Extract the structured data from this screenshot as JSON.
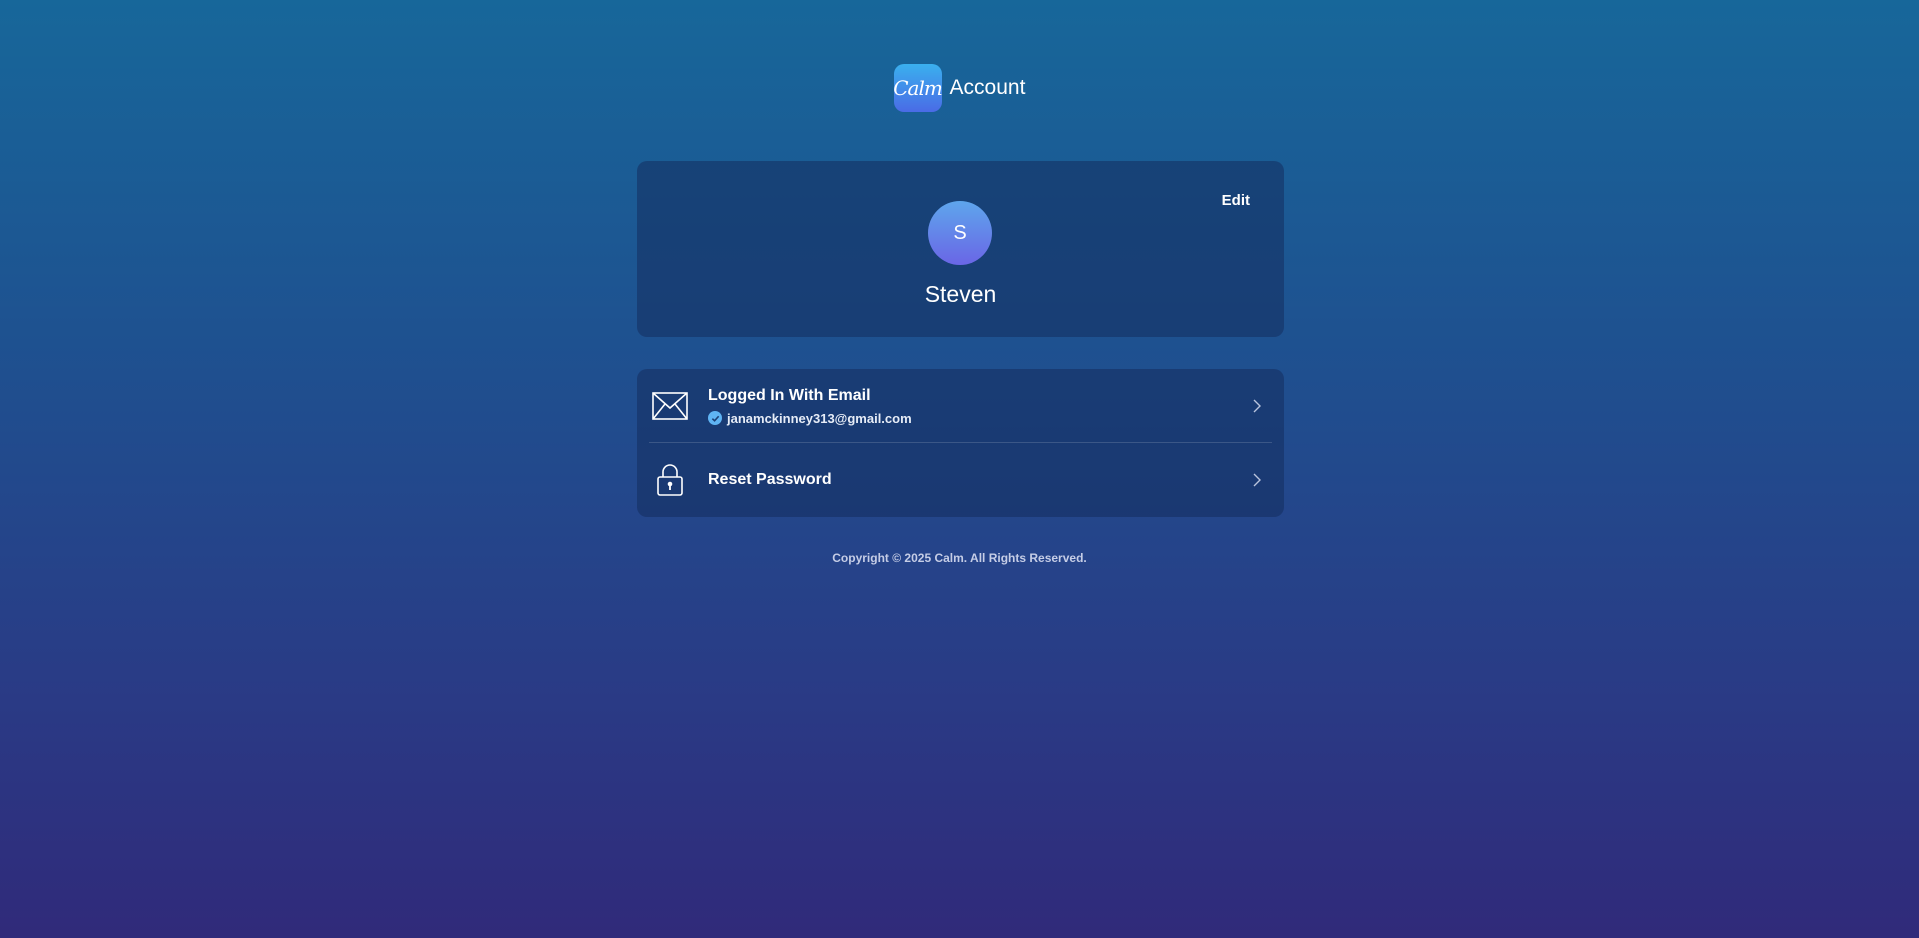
{
  "header": {
    "logo_text": "Calm",
    "title": "Account",
    "logo_gradient": [
      "#3ab0ee",
      "#4a6be6"
    ]
  },
  "profile": {
    "edit_label": "Edit",
    "avatar_initial": "S",
    "name": "Steven"
  },
  "settings": {
    "items": [
      {
        "icon": "envelope-icon",
        "title": "Logged In With Email",
        "subtitle": "janamckinney313@gmail.com",
        "subtitle_icon": "verified-check-icon"
      },
      {
        "icon": "lock-icon",
        "title": "Reset Password"
      }
    ]
  },
  "footer": {
    "copyright": "Copyright © 2025 Calm. All Rights Reserved."
  },
  "colors": {
    "background_top": "#17679a",
    "background_bottom": "#302a7a",
    "card": "#1c3f75",
    "accent_check": "#5fb4f4"
  }
}
